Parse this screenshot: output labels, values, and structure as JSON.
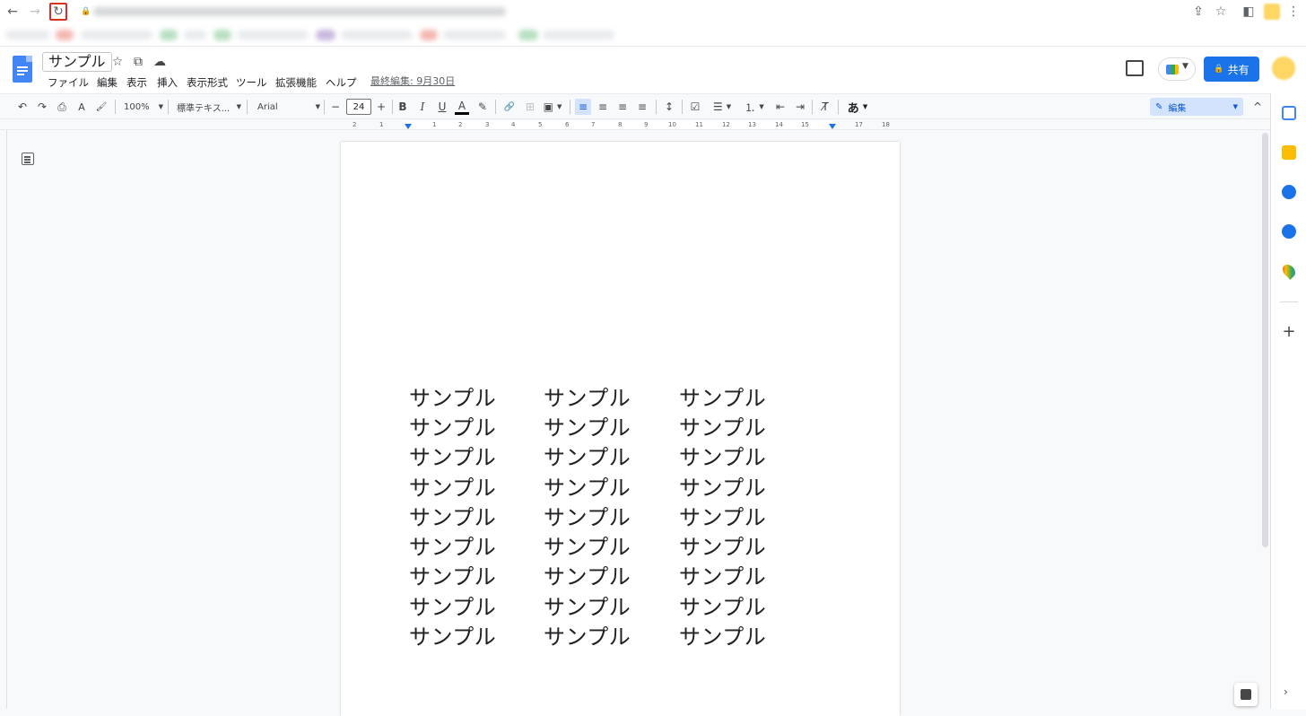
{
  "browser": {
    "back_icon": "←",
    "forward_icon": "→",
    "reload_icon": "↻",
    "lock_icon": "🔒",
    "share_icon": "⇪",
    "star_icon": "☆",
    "sidepanel_icon": "◧",
    "menu_icon": "⋮"
  },
  "doc": {
    "title": "サンプル",
    "star_icon": "☆",
    "move_icon": "⧉",
    "cloud_icon": "☁",
    "menu": [
      "ファイル",
      "編集",
      "表示",
      "挿入",
      "表示形式",
      "ツール",
      "拡張機能",
      "ヘルプ"
    ],
    "last_edit": "最終編集: 9月30日",
    "share_label": "共有",
    "share_lock_icon": "🔒"
  },
  "toolbar": {
    "undo": "↶",
    "redo": "↷",
    "print": "⎙",
    "spellcheck": "A",
    "paint_format": "🖌",
    "zoom": "100%",
    "style": "標準テキス...",
    "font": "Arial",
    "minus": "−",
    "font_size": "24",
    "plus": "+",
    "bold": "B",
    "italic": "I",
    "underline": "U",
    "text_color": "A",
    "highlight": "✎",
    "link": "🔗",
    "comment": "⊞",
    "image": "▣",
    "align_left": "≡",
    "align_center": "≡",
    "align_right": "≡",
    "justify": "≡",
    "line_spacing": "↕",
    "checklist": "☑",
    "bullets": "☰",
    "numbered": "⒈",
    "outdent": "⇤",
    "indent": "⇥",
    "clear_format": "T̸",
    "input_tools": "あ",
    "edit_mode": "編集",
    "collapse": "^"
  },
  "ruler": {
    "ticks": [
      "2",
      "1",
      "1",
      "1",
      "2",
      "3",
      "4",
      "5",
      "6",
      "7",
      "8",
      "9",
      "10",
      "11",
      "12",
      "13",
      "14",
      "15",
      "16",
      "17",
      "18"
    ]
  },
  "body": {
    "rows": [
      [
        "サンプル",
        "サンプル",
        "サンプル"
      ],
      [
        "サンプル",
        "サンプル",
        "サンプル"
      ],
      [
        "サンプル",
        "サンプル",
        "サンプル"
      ],
      [
        "サンプル",
        "サンプル",
        "サンプル"
      ],
      [
        "サンプル",
        "サンプル",
        "サンプル"
      ],
      [
        "サンプル",
        "サンプル",
        "サンプル"
      ],
      [
        "サンプル",
        "サンプル",
        "サンプル"
      ],
      [
        "サンプル",
        "サンプル",
        "サンプル"
      ],
      [
        "サンプル",
        "サンプル",
        "サンプル"
      ]
    ]
  },
  "side_panel": {
    "apps": [
      "calendar-icon",
      "keep-icon",
      "tasks-icon",
      "contacts-icon",
      "maps-icon"
    ],
    "add": "+",
    "collapse": "›"
  },
  "colors": {
    "accent": "#1a73e8",
    "reload_highlight": "#d93025"
  }
}
